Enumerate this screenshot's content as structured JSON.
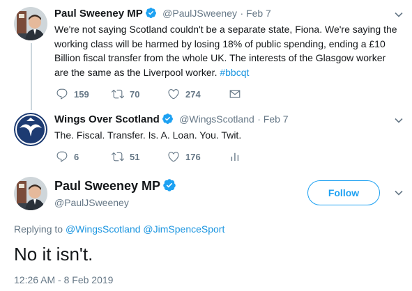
{
  "tweet1": {
    "author_name": "Paul Sweeney MP",
    "handle": "@PaulJSweeney",
    "date": "Feb 7",
    "text": "We're not saying Scotland couldn't be a separate state, Fiona. We're saying the working class will be harmed by losing 18% of public spending, ending a £10 Billion fiscal transfer from the whole UK. The interests of the Glasgow worker are the same as the Liverpool worker.",
    "hashtag": "#bbcqt",
    "replies": "159",
    "retweets": "70",
    "likes": "274"
  },
  "tweet2": {
    "author_name": "Wings Over Scotland",
    "handle": "@WingsScotland",
    "date": "Feb 7",
    "text": "The. Fiscal. Transfer. Is. A. Loan. You. Twit.",
    "replies": "6",
    "retweets": "51",
    "likes": "176"
  },
  "main_tweet": {
    "author_name": "Paul Sweeney MP",
    "handle": "@PaulJSweeney",
    "follow_label": "Follow",
    "replying_to_label": "Replying to",
    "reply_mention_1": "@WingsScotland",
    "reply_mention_2": "@JimSpenceSport",
    "text": "No it isn't.",
    "timestamp": "12:26 AM - 8 Feb 2019"
  },
  "colors": {
    "brand_blue": "#1da1f2",
    "link_blue": "#1b95e0",
    "thread_line": "#ccd6dd",
    "muted": "#657786"
  }
}
